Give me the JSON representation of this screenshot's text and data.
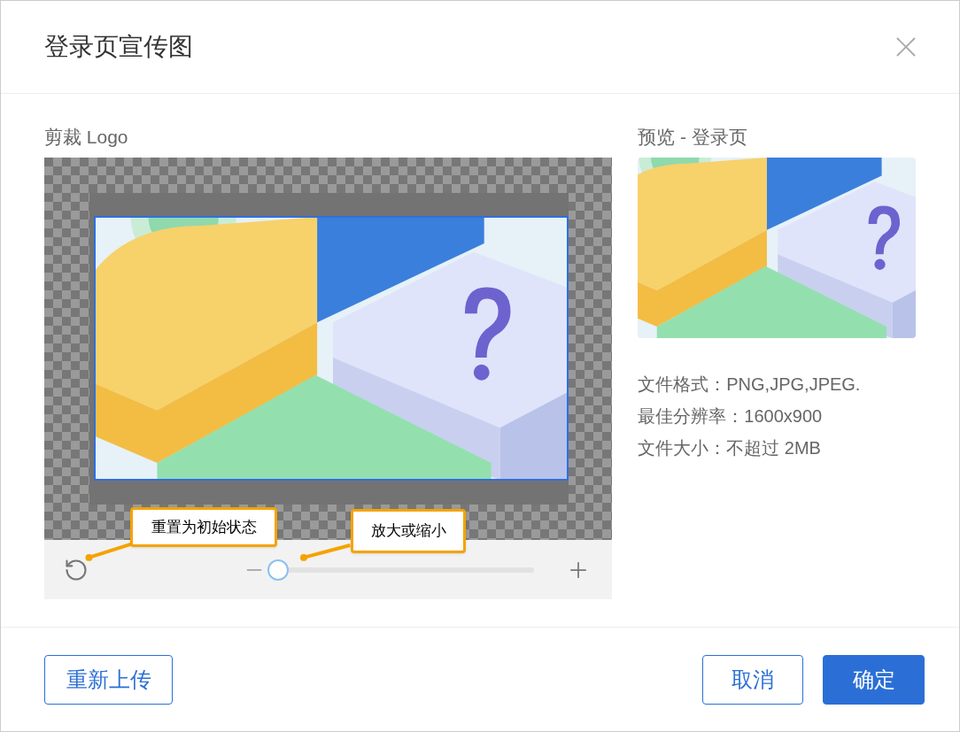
{
  "dialog": {
    "title": "登录页宣传图"
  },
  "cropper": {
    "label": "剪裁 Logo",
    "zoom": {
      "level": 0
    }
  },
  "callouts": [
    {
      "kind": "reset",
      "text": "重置为初始状态"
    },
    {
      "kind": "zoom",
      "text": "放大或缩小"
    }
  ],
  "preview": {
    "label": "预览 - 登录页",
    "info": [
      "文件格式：PNG,JPG,JPEG.",
      "最佳分辨率：1600x900",
      "文件大小：不超过 2MB"
    ]
  },
  "buttons": [
    {
      "label": "重新上传",
      "kind": "outline"
    },
    {
      "label": "取消",
      "kind": "outline"
    },
    {
      "label": "确定",
      "kind": "primary"
    }
  ]
}
